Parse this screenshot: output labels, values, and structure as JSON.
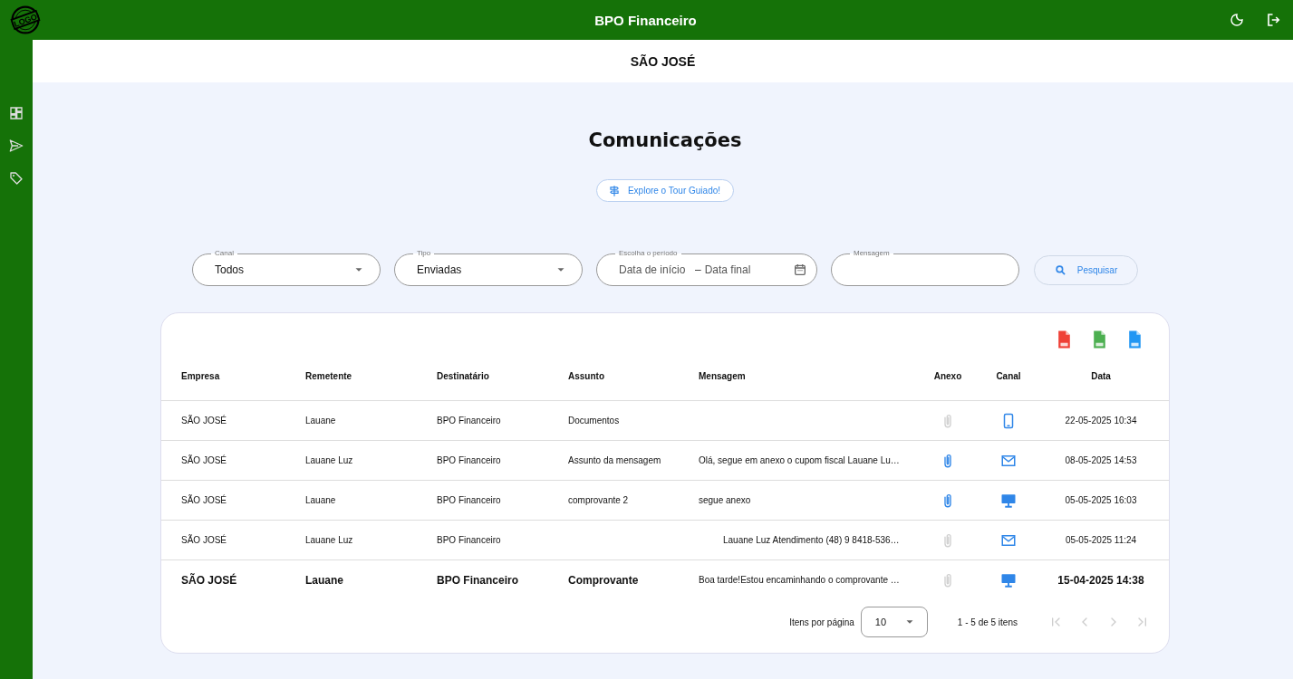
{
  "app_bar": {
    "logo_text": "LOGO",
    "title": "BPO Financeiro"
  },
  "sidebar": {
    "items": [
      {
        "kind": "dashboard"
      },
      {
        "kind": "send"
      },
      {
        "kind": "tag"
      }
    ]
  },
  "company_header": "SÃO JOSÉ",
  "page_title": "Comunicações",
  "tour_button": "Explore o Tour Guiado!",
  "filters": [
    {
      "kind": "select",
      "label": "Canal",
      "value": "Todos"
    },
    {
      "kind": "select",
      "label": "Tipo",
      "value": "Enviadas"
    },
    {
      "kind": "daterange",
      "label": "Escolha o período",
      "start_placeholder": "Data de início",
      "separator": "–",
      "end_placeholder": "Data final"
    },
    {
      "kind": "text",
      "label": "Mensagem"
    }
  ],
  "search_button": "Pesquisar",
  "exports": [
    {
      "kind": "pdf"
    },
    {
      "kind": "xls"
    },
    {
      "kind": "csv"
    }
  ],
  "table": {
    "columns": [
      "Empresa",
      "Remetente",
      "Destinatário",
      "Assunto",
      "Mensagem",
      "Anexo",
      "Canal",
      "Data"
    ],
    "rows": [
      {
        "bold": false,
        "empresa": "SÃO JOSÉ",
        "remetente": "Lauane",
        "destinatario": "BPO Financeiro",
        "assunto": "Documentos",
        "mensagem": "",
        "attachment": false,
        "channel": {
          "kind": "mobile"
        },
        "data": "22-05-2025 10:34"
      },
      {
        "bold": false,
        "empresa": "SÃO JOSÉ",
        "remetente": "Lauane Luz",
        "destinatario": "BPO Financeiro",
        "assunto": "Assunto da mensagem",
        "mensagem": "Olá, segue em anexo o cupom fiscal Lauane Lu…",
        "indented": false,
        "attachment": true,
        "channel": {
          "kind": "email"
        },
        "data": "08-05-2025 14:53"
      },
      {
        "bold": false,
        "empresa": "SÃO JOSÉ",
        "remetente": "Lauane",
        "destinatario": "BPO Financeiro",
        "assunto": "comprovante 2",
        "mensagem": "segue anexo",
        "indented": false,
        "attachment": true,
        "channel": {
          "kind": "desktop"
        },
        "data": "05-05-2025 16:03"
      },
      {
        "bold": false,
        "empresa": "SÃO JOSÉ",
        "remetente": "Lauane Luz",
        "destinatario": "BPO Financeiro",
        "assunto": "",
        "mensagem": "Lauane Luz Atendimento (48) 9 8418-536…",
        "indented": true,
        "attachment": false,
        "channel": {
          "kind": "email"
        },
        "data": "05-05-2025 11:24"
      },
      {
        "bold": true,
        "empresa": "SÃO JOSÉ",
        "remetente": "Lauane",
        "destinatario": "BPO Financeiro",
        "assunto": "Comprovante",
        "mensagem": "Boa tarde!Estou encaminhando o comprovante …",
        "indented": false,
        "attachment": false,
        "channel": {
          "kind": "desktop"
        },
        "data": "15-04-2025 14:38"
      }
    ]
  },
  "pagination": {
    "page_size_label": "Itens por página",
    "page_size": "10",
    "range": "1 - 5 de 5 itens",
    "first_disabled": true,
    "prev_disabled": true,
    "next_disabled": true,
    "last_disabled": true
  }
}
